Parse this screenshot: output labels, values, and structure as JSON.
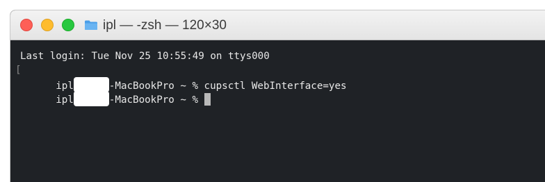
{
  "window": {
    "title": "ipl — -zsh — 120×30",
    "title_icon": "folder-icon"
  },
  "terminal": {
    "last_login": "Last login: Tue Nov 25 10:55:49 on ttys000",
    "lines": [
      {
        "prompt_user_prefix": "ipl",
        "prompt_host_suffix": "-MacBookPro ~ %",
        "command": " cupsctl WebInterface=yes"
      },
      {
        "prompt_user_prefix": "ipl",
        "prompt_host_suffix": "-MacBookPro ~ %",
        "command": " "
      }
    ],
    "mark_bracket": "["
  },
  "colors": {
    "close": "#fe5f57",
    "minimize": "#febc2e",
    "maximize": "#28c840",
    "terminal_bg": "#1f2226",
    "terminal_fg": "#e8e8e8"
  }
}
